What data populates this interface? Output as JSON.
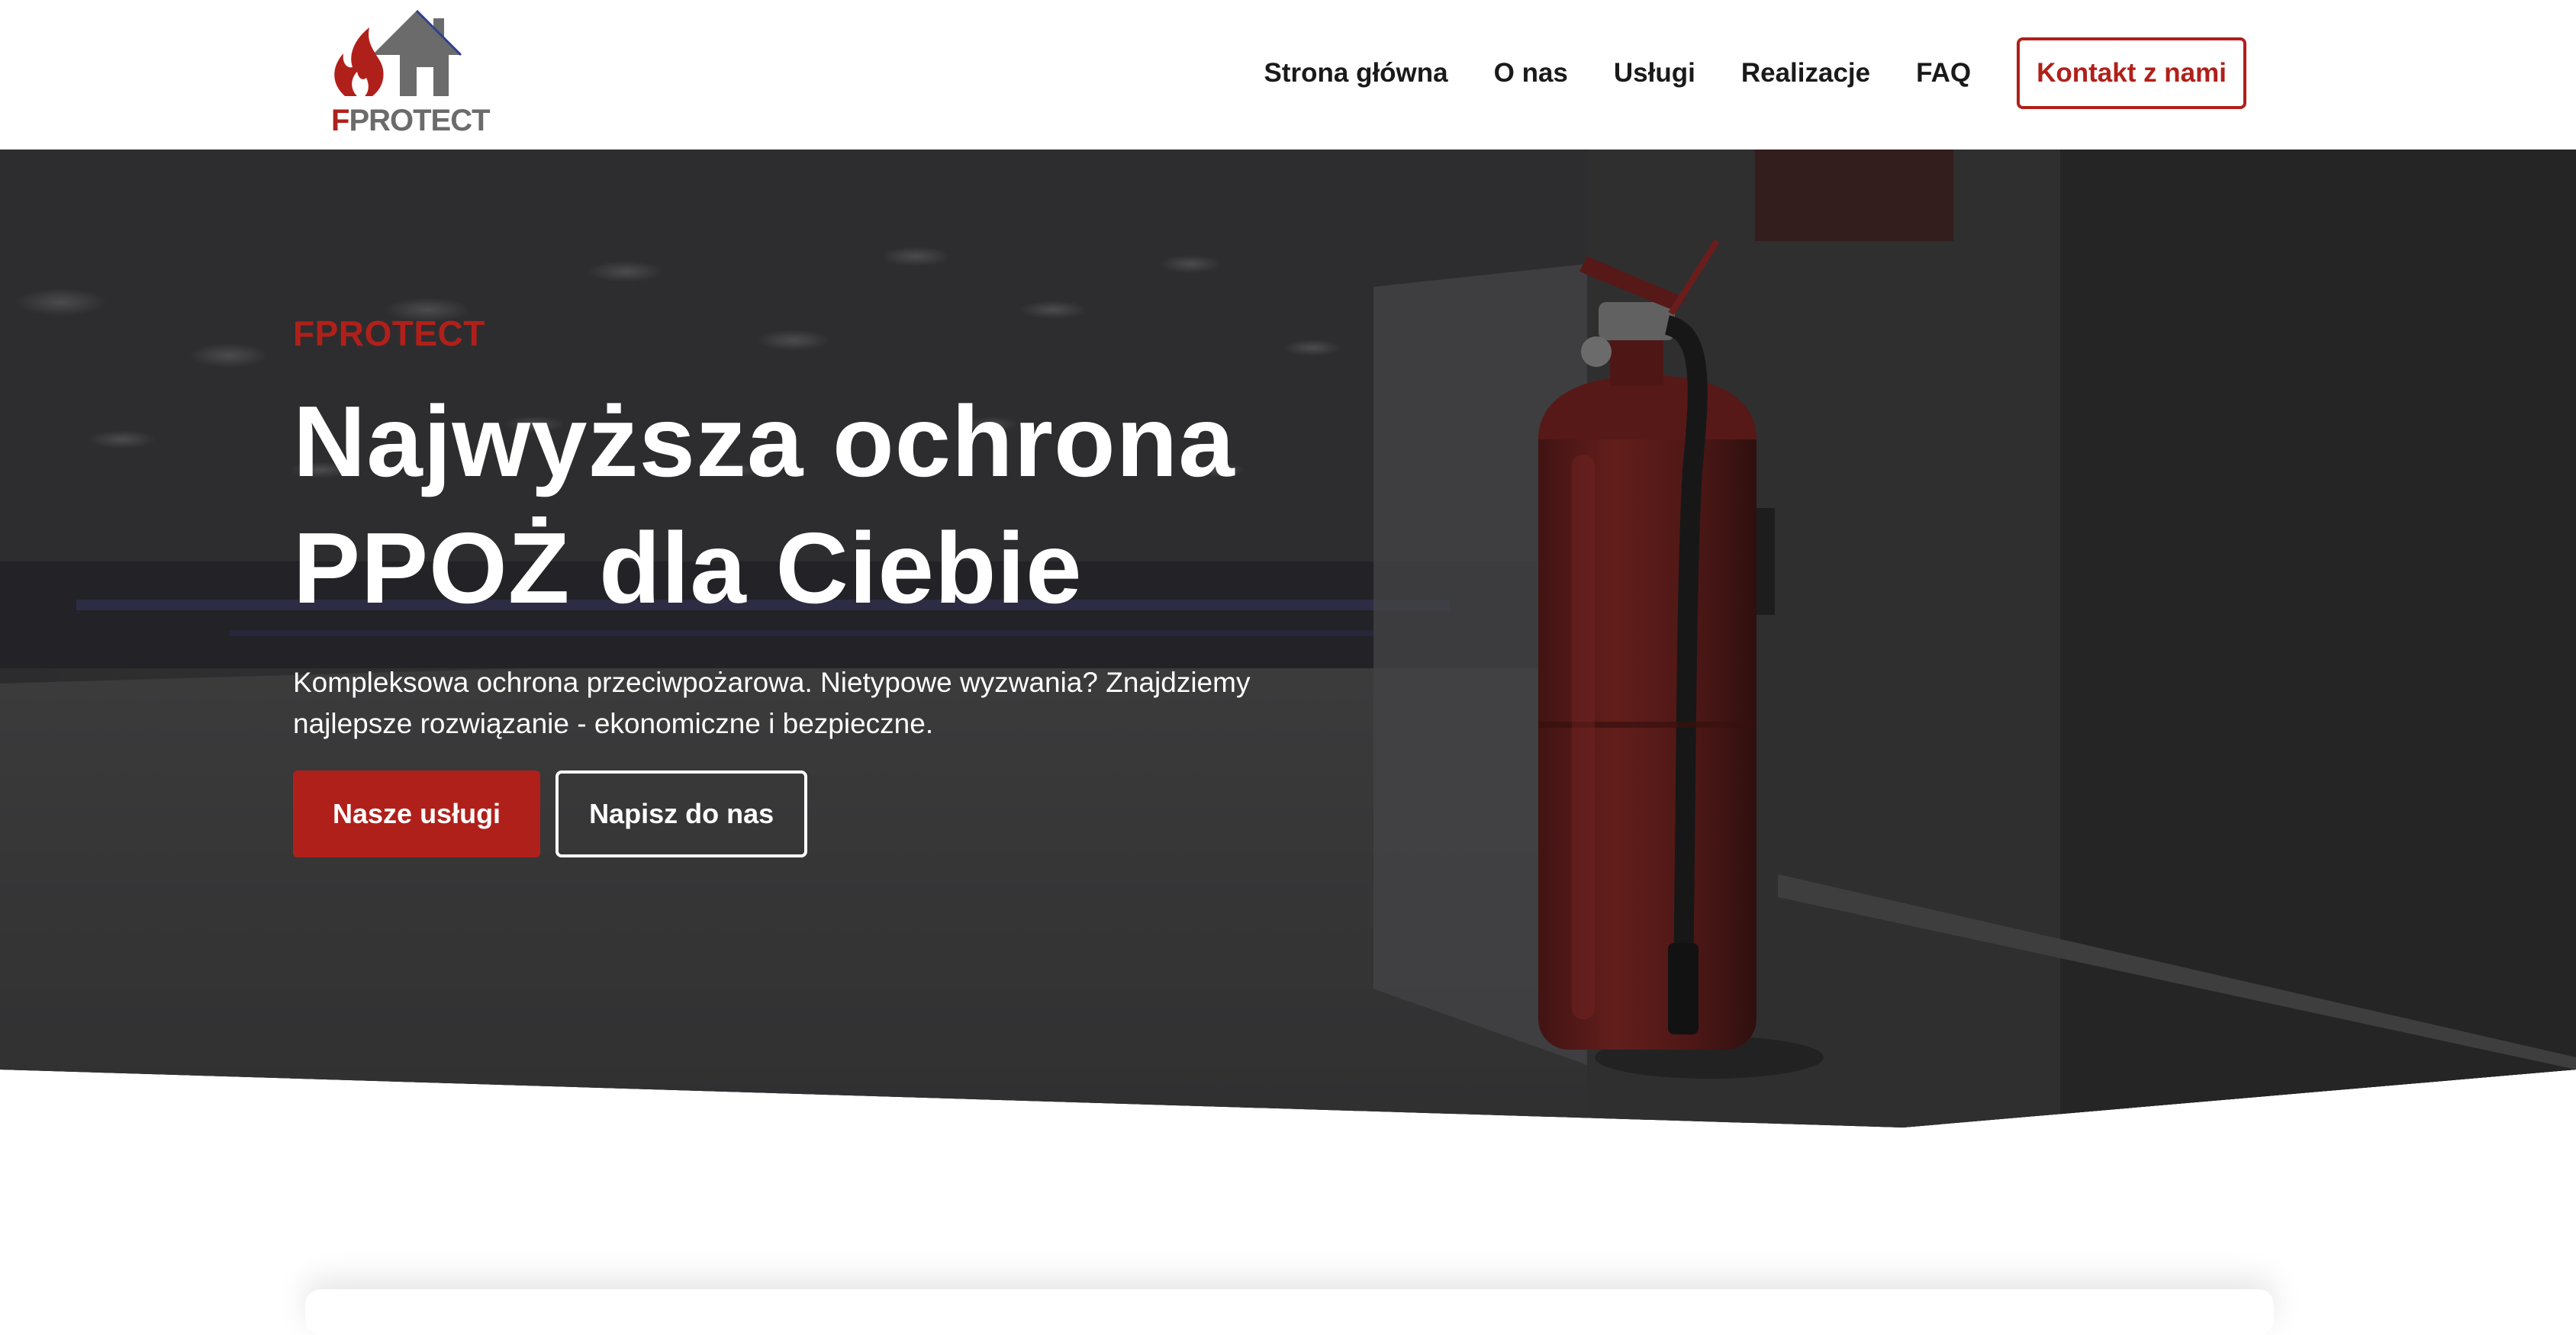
{
  "brand": {
    "logo_text_first": "F",
    "logo_text_rest": "PROTECT",
    "color_primary": "#b0201a",
    "color_logo_gray": "#6b6b6b"
  },
  "nav": {
    "items": [
      {
        "label": "Strona główna"
      },
      {
        "label": "O nas"
      },
      {
        "label": "Usługi"
      },
      {
        "label": "Realizacje"
      },
      {
        "label": "FAQ"
      }
    ],
    "cta_label": "Kontakt z nami"
  },
  "hero": {
    "eyebrow": "FPROTECT",
    "headline_line1": "Najwyższa ochrona",
    "headline_line2": "PPOŻ dla Ciebie",
    "lead_line1": "Kompleksowa ochrona przeciwpożarowa. Nietypowe wyzwania? Znajdziemy",
    "lead_line2": "najlepsze rozwiązanie - ekonomiczne i bezpieczne.",
    "primary_button": "Nasze usługi",
    "secondary_button": "Napisz do nas",
    "background_icon": "fire-extinguisher-icon"
  }
}
